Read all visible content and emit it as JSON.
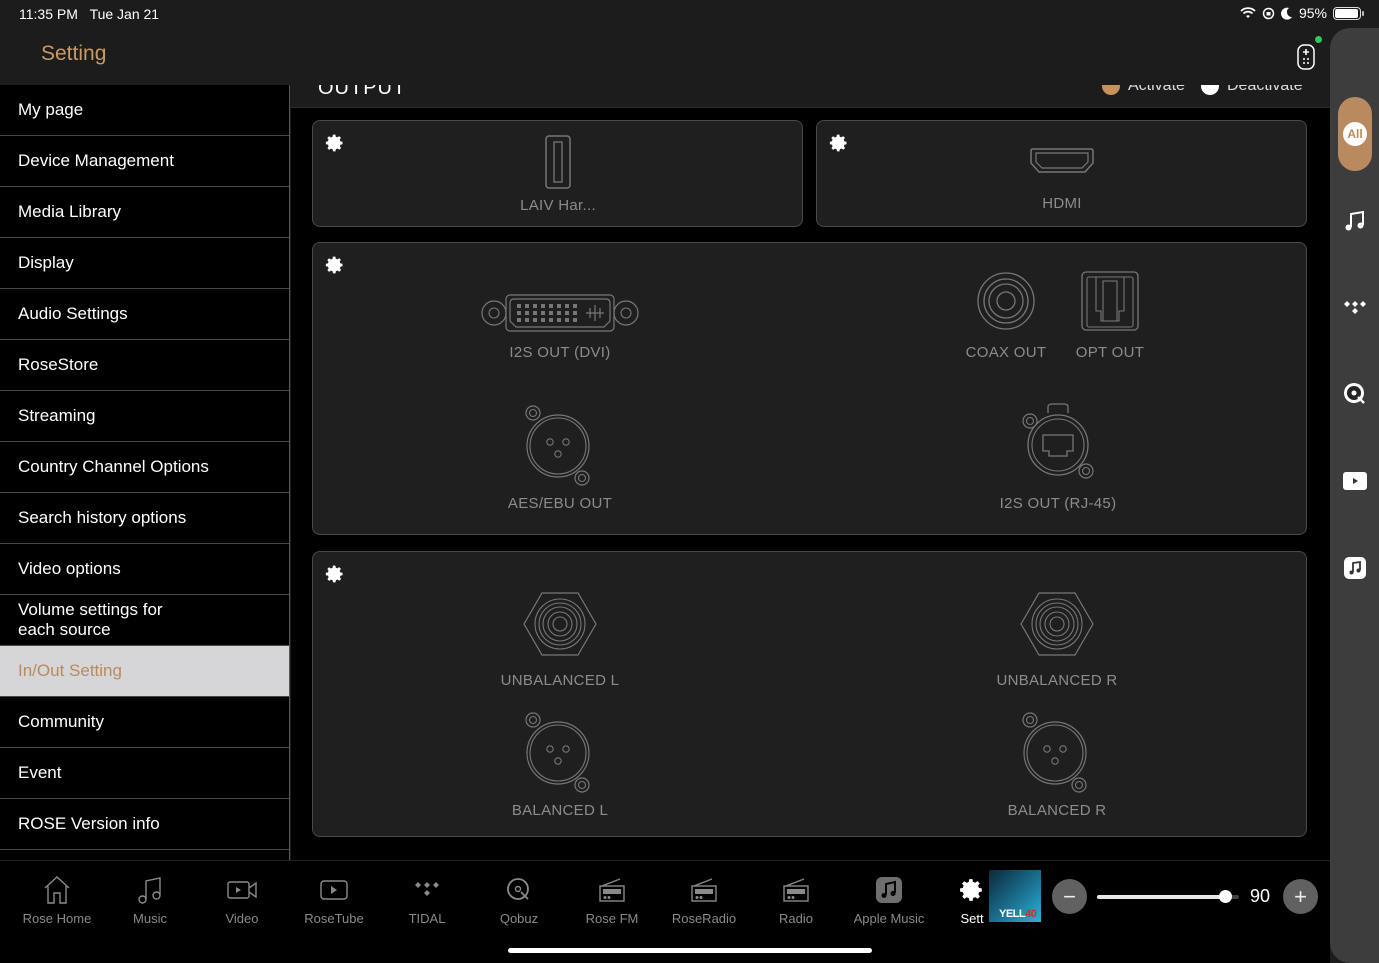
{
  "status_bar": {
    "time": "11:35 PM",
    "date": "Tue Jan 21",
    "battery": "95%",
    "battery_level": 0.95
  },
  "header": {
    "title": "Setting"
  },
  "sidebar": {
    "items": [
      {
        "label": "My page",
        "active": false
      },
      {
        "label": "Device Management",
        "active": false
      },
      {
        "label": "Media Library",
        "active": false
      },
      {
        "label": "Display",
        "active": false
      },
      {
        "label": "Audio Settings",
        "active": false
      },
      {
        "label": "RoseStore",
        "active": false
      },
      {
        "label": "Streaming",
        "active": false
      },
      {
        "label": "Country Channel Options",
        "active": false
      },
      {
        "label": "Search history options",
        "active": false
      },
      {
        "label": "Video options",
        "active": false
      },
      {
        "label": "Volume settings for each source",
        "active": false
      },
      {
        "label": "In/Out Setting",
        "active": true
      },
      {
        "label": "Community",
        "active": false
      },
      {
        "label": "Event",
        "active": false
      },
      {
        "label": "ROSE Version info",
        "active": false
      }
    ]
  },
  "main": {
    "section_title": "OUTPUT",
    "legend": {
      "activate": "Activate",
      "deactivate": "Deactivate",
      "activate_color": "#c8925e",
      "deactivate_color": "#ffffff"
    },
    "cards": [
      {
        "ports": [
          {
            "label": "LAIV Har...",
            "icon": "usb-port-icon"
          }
        ]
      },
      {
        "ports": [
          {
            "label": "HDMI",
            "icon": "hdmi-port-icon"
          }
        ]
      },
      {
        "ports": [
          {
            "label": "I2S OUT (DVI)",
            "icon": "dvi-port-icon"
          },
          {
            "label": "COAX OUT",
            "icon": "coax-port-icon"
          },
          {
            "label": "OPT OUT",
            "icon": "optical-port-icon"
          },
          {
            "label": "AES/EBU OUT",
            "icon": "xlr-port-icon"
          },
          {
            "label": "I2S OUT (RJ-45)",
            "icon": "rj45-port-icon"
          }
        ]
      },
      {
        "ports": [
          {
            "label": "UNBALANCED L",
            "icon": "rca-port-icon"
          },
          {
            "label": "UNBALANCED R",
            "icon": "rca-port-icon"
          },
          {
            "label": "BALANCED L",
            "icon": "xlr-port-icon"
          },
          {
            "label": "BALANCED R",
            "icon": "xlr-port-icon"
          }
        ]
      }
    ]
  },
  "rail": {
    "all_label": "All",
    "accent": "#b98a5e",
    "icons": [
      "music-note-icon",
      "tidal-icon",
      "qobuz-icon",
      "youtube-icon",
      "apple-music-icon"
    ]
  },
  "bottom_tabs": [
    {
      "label": "Rose Home",
      "icon": "home-icon"
    },
    {
      "label": "Music",
      "icon": "music-note-icon"
    },
    {
      "label": "Video",
      "icon": "video-camera-icon"
    },
    {
      "label": "RoseTube",
      "icon": "play-box-icon"
    },
    {
      "label": "TIDAL",
      "icon": "tidal-icon"
    },
    {
      "label": "Qobuz",
      "icon": "qobuz-icon"
    },
    {
      "label": "Rose FM",
      "icon": "radio-icon"
    },
    {
      "label": "RoseRadio",
      "icon": "radio-icon"
    },
    {
      "label": "Radio",
      "icon": "radio-icon"
    },
    {
      "label": "Apple Music",
      "icon": "apple-music-icon"
    },
    {
      "label": "Sett",
      "icon": "gear-icon"
    }
  ],
  "player": {
    "album_text": "YELL",
    "album_text_accent": "40",
    "volume": 90,
    "volume_max": 100,
    "minus": "−",
    "plus": "+"
  }
}
